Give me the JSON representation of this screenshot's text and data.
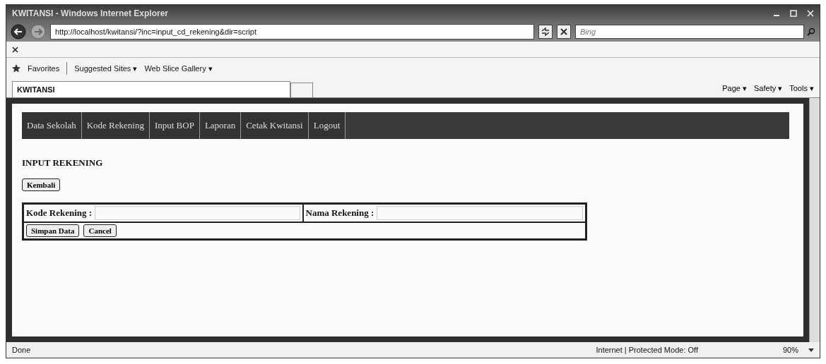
{
  "window": {
    "title": "KWITANSI - Windows Internet Explorer"
  },
  "address_bar": {
    "url": "http://localhost/kwitansi/?inc=input_cd_rekening&dir=script"
  },
  "search": {
    "placeholder": "Bing"
  },
  "favorites_bar": {
    "favorites": "Favorites",
    "links": [
      "Suggested Sites ▾",
      "Web Slice Gallery ▾"
    ]
  },
  "tab": {
    "title": "KWITANSI"
  },
  "command_bar": [
    "Page ▾",
    "Safety ▾",
    "Tools ▾"
  ],
  "page": {
    "menu": [
      {
        "label": "Data Sekolah"
      },
      {
        "label": "Kode Rekening"
      },
      {
        "label": "Input BOP"
      },
      {
        "label": "Laporan"
      },
      {
        "label": "Cetak Kwitansi"
      },
      {
        "label": "Logout"
      }
    ],
    "heading": "INPUT REKENING",
    "back_button": "Kembali",
    "form": {
      "fields": [
        {
          "label": "Kode Rekening :"
        },
        {
          "label": "Nama Rekening :"
        }
      ],
      "buttons": [
        "Simpan Data",
        "Cancel"
      ]
    }
  },
  "status_bar": {
    "status": "Done",
    "zone": "Internet | Protected Mode: Off",
    "zoom": "90%"
  }
}
